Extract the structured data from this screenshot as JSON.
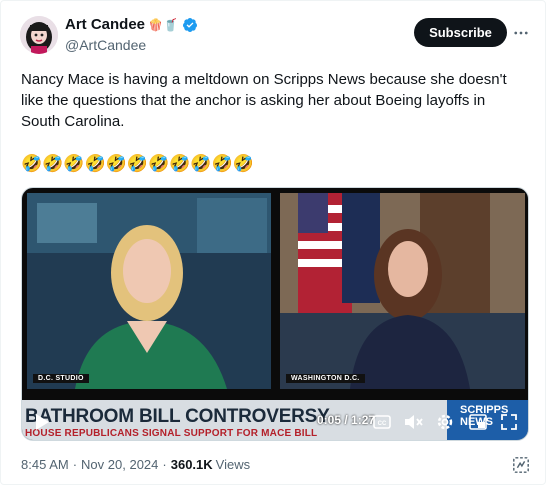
{
  "author": {
    "display_name": "Art Candee",
    "name_emojis": "🍿🥤",
    "handle": "@ArtCandee",
    "verified_color": "#1d9bf0"
  },
  "actions": {
    "subscribe_label": "Subscribe",
    "more_icon": "more-horizontal-icon"
  },
  "tweet": {
    "text": "Nancy Mace is having a meltdown on Scripps News because she doesn't like the questions that the anchor is asking her about Boeing layoffs in South Carolina.",
    "emojis": "🤣🤣🤣🤣🤣🤣🤣🤣🤣🤣🤣"
  },
  "video": {
    "left_location": "D.C. STUDIO",
    "right_location": "WASHINGTON D.C.",
    "chyron_title": "BATHROOM BILL CONTROVERSY",
    "chyron_subtitle": "HOUSE REPUBLICANS SIGNAL SUPPORT FOR MACE BILL",
    "brand_line1": "SCRIPPS",
    "brand_line2": "NEWS",
    "time": "0:05 / 1:27",
    "controls": [
      "play-icon",
      "captions-icon",
      "mute-icon",
      "settings-icon",
      "picture-in-picture-icon",
      "fullscreen-icon"
    ]
  },
  "footer": {
    "time": "8:45 AM",
    "date": "Nov 20, 2024",
    "views_count": "360.1K",
    "views_label": "Views"
  }
}
